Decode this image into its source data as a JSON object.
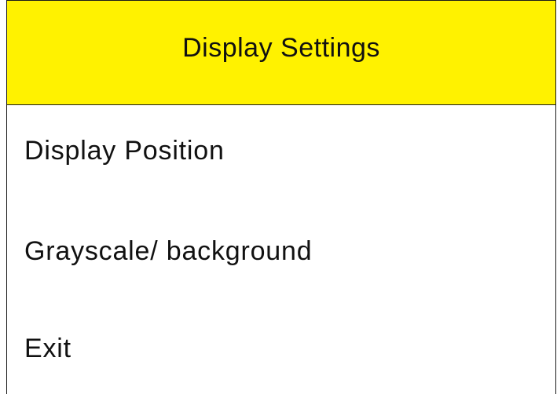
{
  "header": {
    "title": "Display Settings",
    "background_color": "#fff200"
  },
  "menu": {
    "items": [
      {
        "label": "Display Position"
      },
      {
        "label": "Grayscale/ background"
      },
      {
        "label": "Exit"
      }
    ]
  }
}
